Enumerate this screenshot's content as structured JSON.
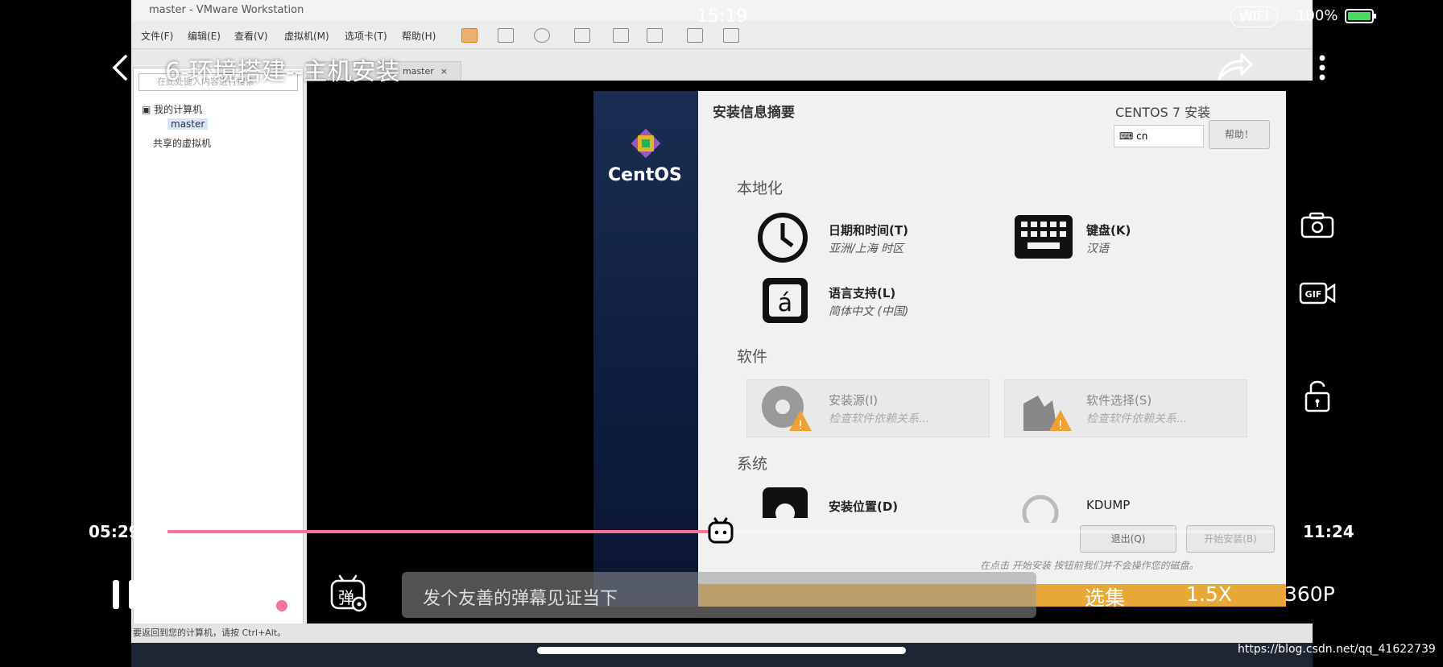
{
  "status_bar": {
    "time": "15:19",
    "network": "WIFI",
    "battery": "100%"
  },
  "video": {
    "title": "6-环境搭建--主机安装",
    "current_time": "05:29",
    "total_time": "11:24",
    "progress": 0.5,
    "danmaku_placeholder": "发个友善的弹幕见证当下",
    "episodes_label": "选集",
    "speed_label": "1.5X",
    "quality_label": "360P",
    "danmaku_toggle": "弹",
    "danmaku_settings": "弹"
  },
  "vmware": {
    "window_title": "master - VMware Workstation",
    "menu": [
      "文件(F)",
      "编辑(E)",
      "查看(V)",
      "虚拟机(M)",
      "选项卡(T)",
      "帮助(H)"
    ],
    "search_placeholder": "在此处键入内容进行搜索",
    "tree": {
      "my_computer": "我的计算机",
      "vm_name": "master",
      "shared": "共享的虚拟机"
    },
    "tab_label": "master",
    "status_text": "要返回到您的计算机，请按 Ctrl+Alt。"
  },
  "installer": {
    "heading": "安装信息摘要",
    "product": "CENTOS 7 安装",
    "keyboard_layout": "cn",
    "help_button": "帮助！",
    "logo_text": "CentOS",
    "sections": {
      "localization": "本地化",
      "software": "软件",
      "system": "系统"
    },
    "spokes": {
      "datetime": {
        "title": "日期和时间(T)",
        "status": "亚洲/上海 时区"
      },
      "keyboard": {
        "title": "键盘(K)",
        "status": "汉语"
      },
      "language": {
        "title": "语言支持(L)",
        "status": "简体中文 (中国)"
      },
      "source": {
        "title": "安装源(I)",
        "status": "检查软件依赖关系..."
      },
      "software_selection": {
        "title": "软件选择(S)",
        "status": "检查软件依赖关系..."
      },
      "destination": {
        "title": "安装位置(D)"
      },
      "kdump": {
        "title": "KDUMP"
      }
    },
    "quit_button": "退出(Q)",
    "begin_button": "开始安装(B)",
    "footer_note": "在点击 开始安装 按钮前我们并不会操作您的磁盘。"
  },
  "watermark": "https://blog.csdn.net/qq_41622739",
  "colors": {
    "progress": "#fb7299",
    "installer_accent": "#e7a838"
  }
}
